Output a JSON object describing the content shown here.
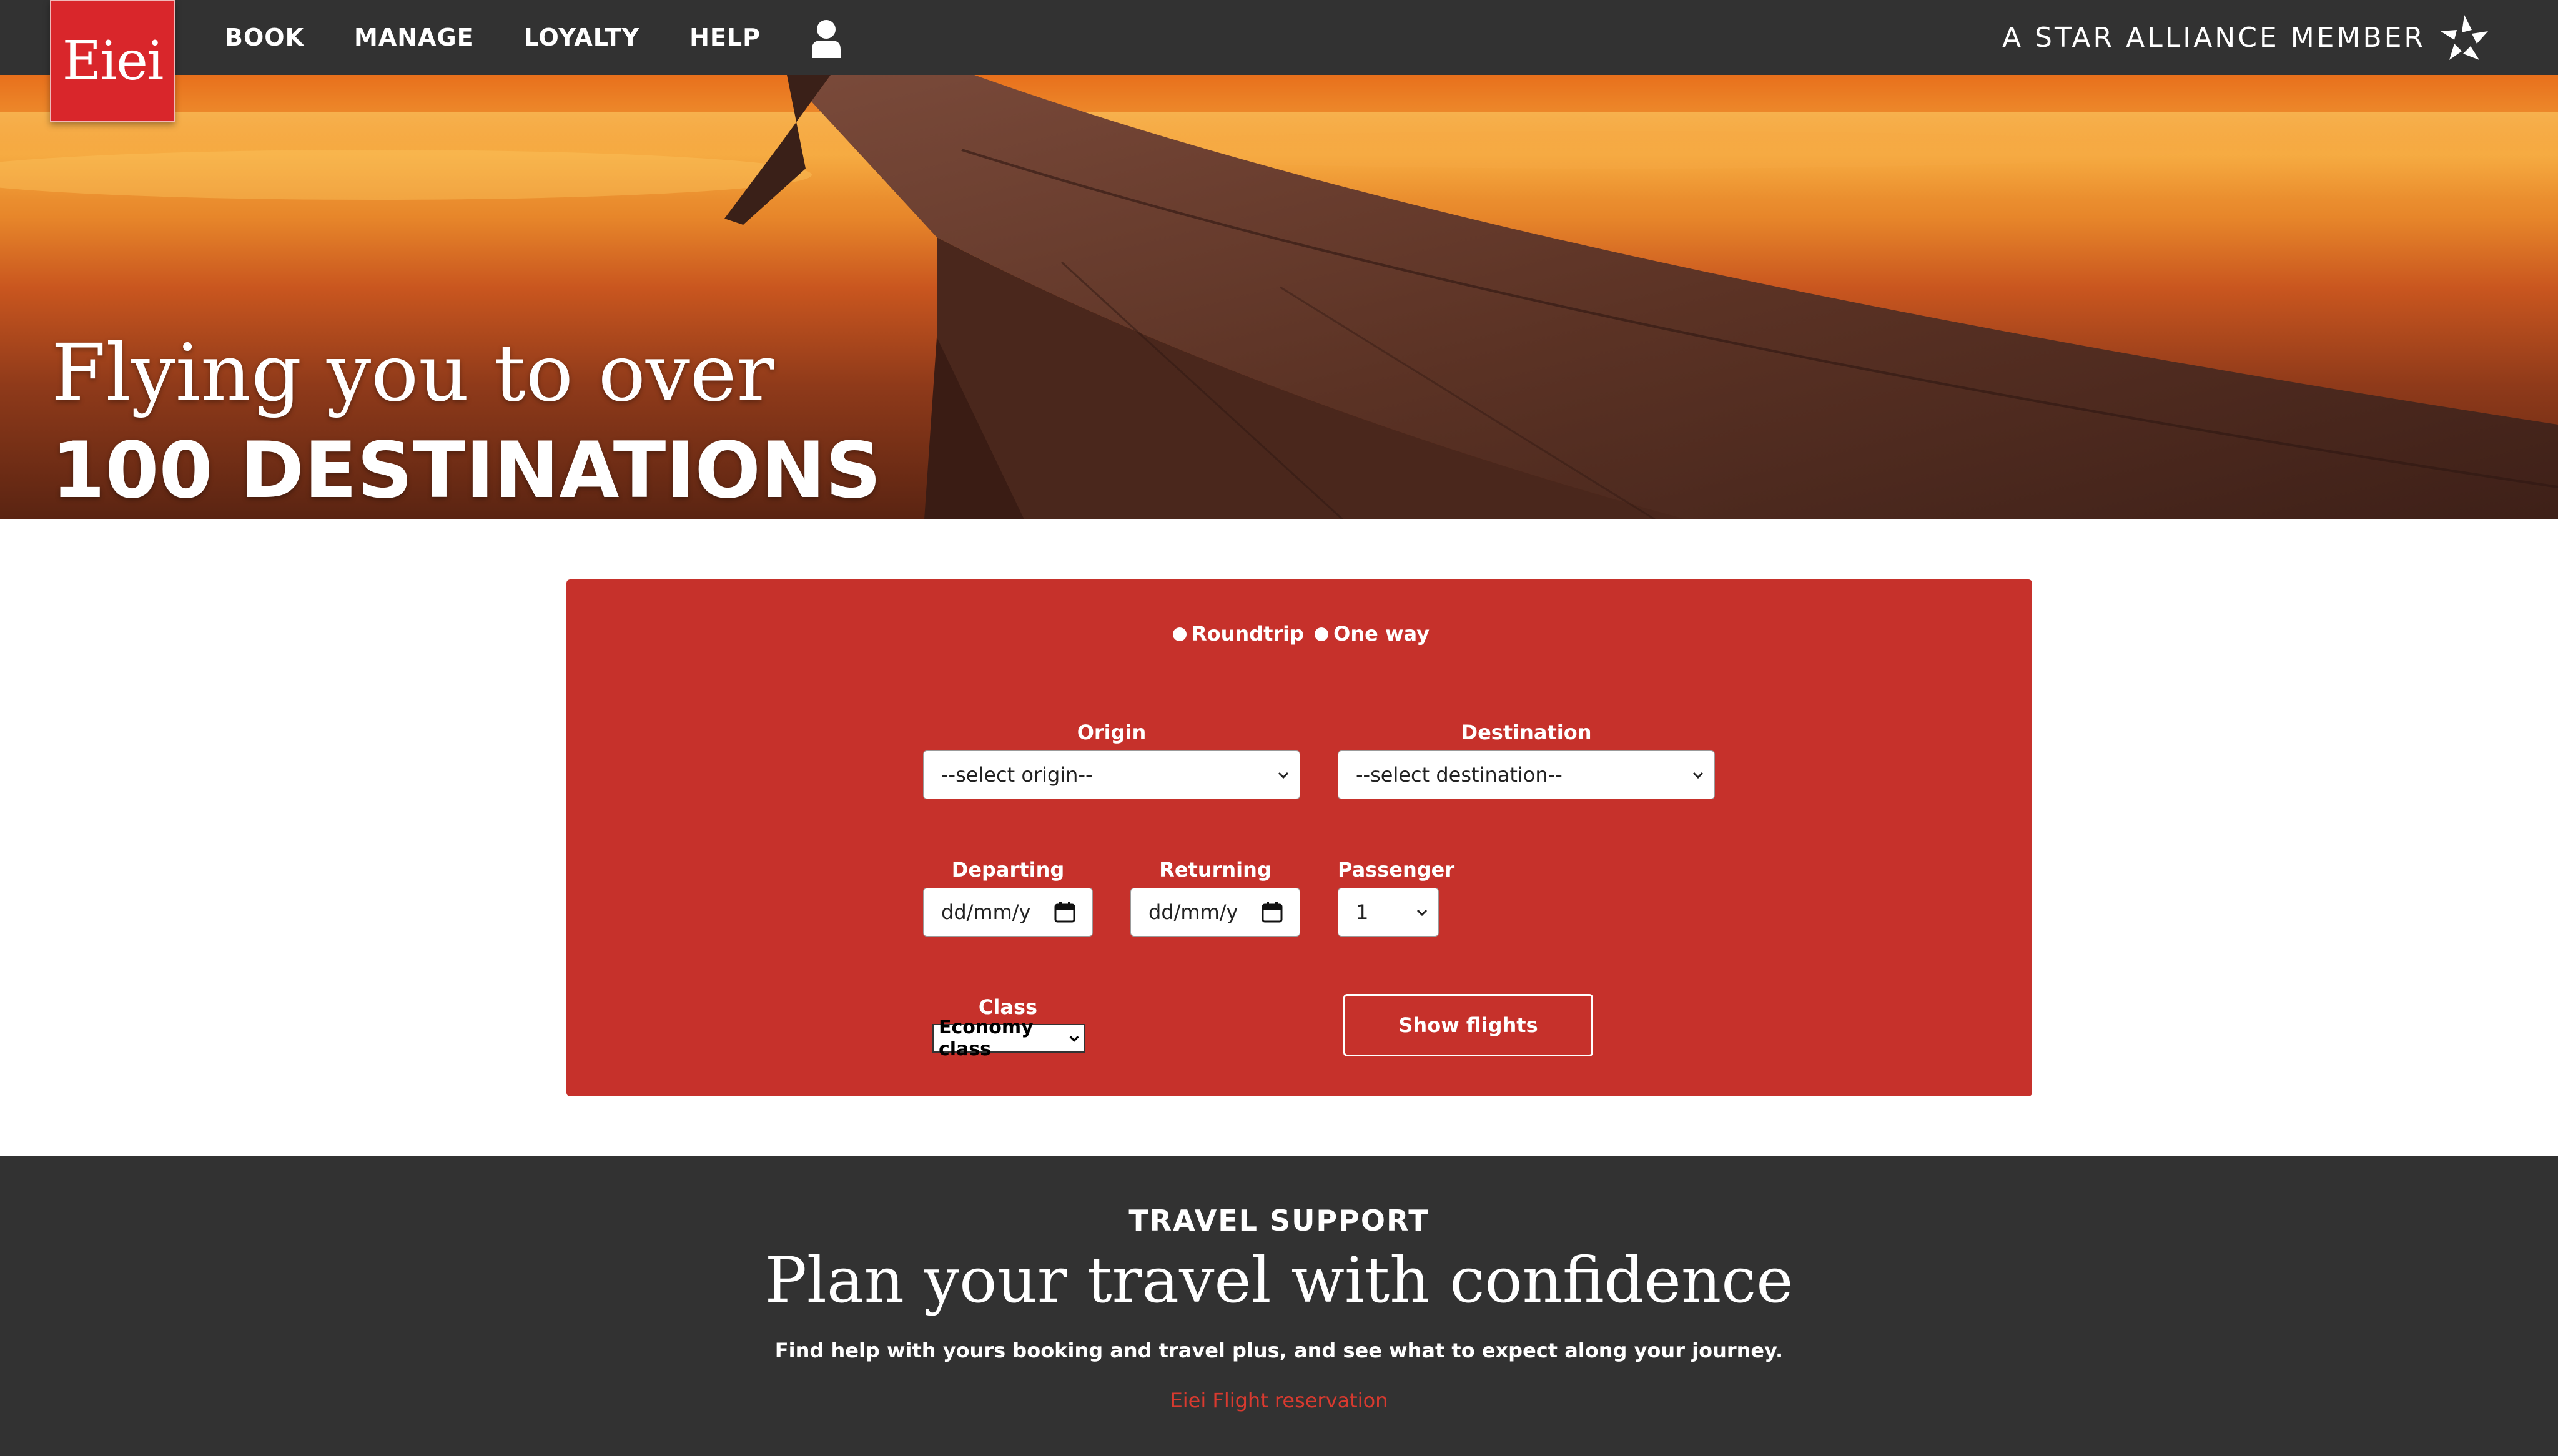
{
  "nav": {
    "logo": "Eiei",
    "items": [
      "BOOK",
      "MANAGE",
      "LOYALTY",
      "HELP"
    ],
    "alliance_text": "A STAR ALLIANCE MEMBER"
  },
  "hero": {
    "line1": "Flying you to over",
    "line2": "100 DESTINATIONS"
  },
  "booking": {
    "trip_options": [
      "Roundtrip",
      "One way"
    ],
    "origin_label": "Origin",
    "origin_value": "--select origin--",
    "destination_label": "Destination",
    "destination_value": "--select destination--",
    "departing_label": "Departing",
    "departing_placeholder": "dd/mm/y",
    "returning_label": "Returning",
    "returning_placeholder": "dd/mm/y",
    "passenger_label": "Passenger",
    "passenger_value": "1",
    "class_label": "Class",
    "class_value": "Economy class",
    "submit_label": "Show flights"
  },
  "support": {
    "kicker": "TRAVEL SUPPORT",
    "headline": "Plan your travel with confidence",
    "description": "Find help with yours booking and travel plus, and see what to expect along your journey.",
    "link": "Eiei Flight reservation"
  },
  "colors": {
    "nav_bg": "#323232",
    "brand_red": "#d9262b",
    "form_red": "#c6312b",
    "link_red": "#d93a2f"
  },
  "icons": [
    "user-icon",
    "star-alliance-icon",
    "chevron-down-icon",
    "calendar-icon"
  ]
}
